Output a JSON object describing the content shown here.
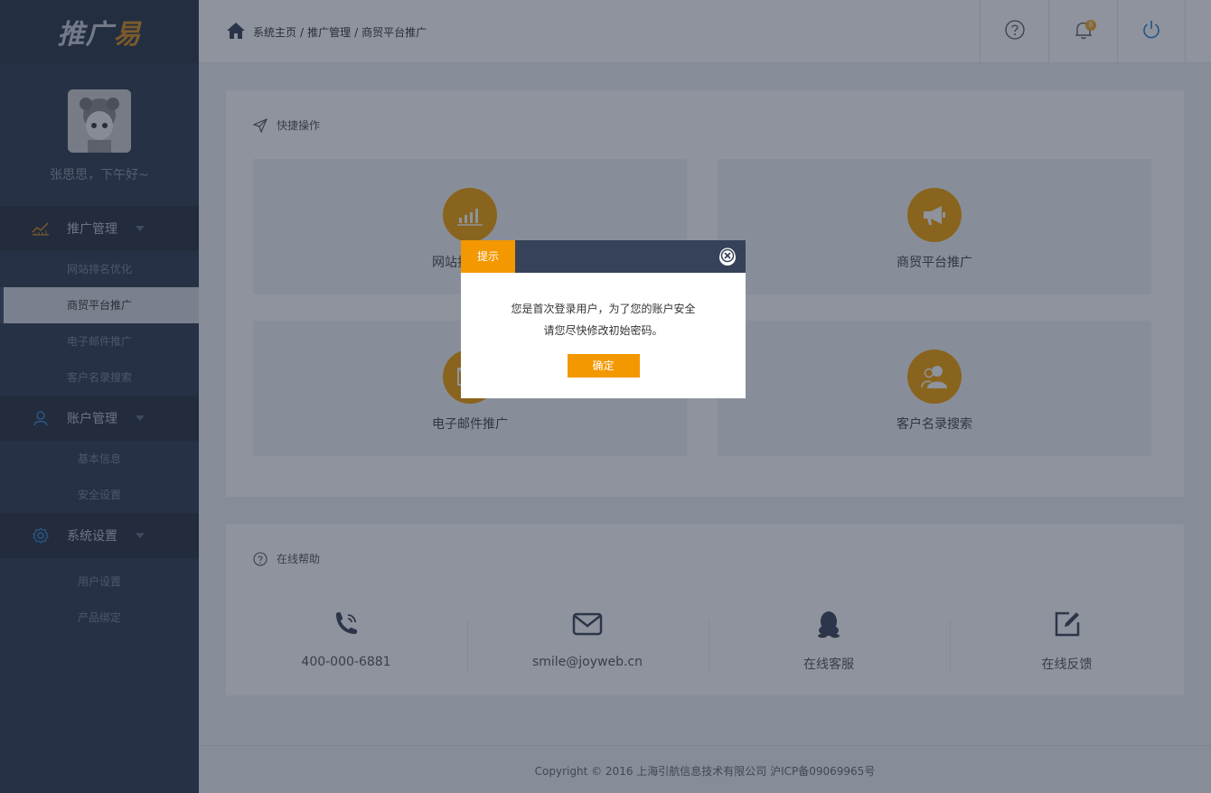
{
  "logo": {
    "text_main": "推广",
    "text_accent": "易"
  },
  "profile": {
    "greeting": "张思思，下午好~"
  },
  "nav": {
    "groups": [
      {
        "label": "推广管理",
        "items": [
          "网站排名优化",
          "商贸平台推广",
          "电子邮件推广",
          "客户名录搜索"
        ],
        "active": "商贸平台推广"
      },
      {
        "label": "账户管理",
        "items": [
          "基本信息",
          "安全设置"
        ]
      },
      {
        "label": "系统设置",
        "items": [
          "用户设置",
          "产品绑定"
        ]
      }
    ]
  },
  "breadcrumb": {
    "items": [
      "系统主页",
      "推广管理",
      "商贸平台推广"
    ],
    "separator": "/"
  },
  "header": {
    "notification_count": "8"
  },
  "quick": {
    "title": "快捷操作",
    "cards": [
      {
        "label": "网站排名优化",
        "icon": "bar-chart-icon"
      },
      {
        "label": "商贸平台推广",
        "icon": "megaphone-icon"
      },
      {
        "label": "电子邮件推广",
        "icon": "mail-icon"
      },
      {
        "label": "客户名录搜索",
        "icon": "users-icon"
      }
    ]
  },
  "help": {
    "title": "在线帮助",
    "items": [
      {
        "label": "400-000-6881",
        "icon": "phone-icon"
      },
      {
        "label": "smile@joyweb.cn",
        "icon": "envelope-icon"
      },
      {
        "label": "在线客服",
        "icon": "qq-icon"
      },
      {
        "label": "在线反馈",
        "icon": "feedback-icon"
      }
    ]
  },
  "footer": {
    "text": "Copyright © 2016 上海引航信息技术有限公司  沪ICP备09069965号"
  },
  "dialog": {
    "title": "提示",
    "line1": "您是首次登录用户，为了您的账户安全",
    "line2": "请您尽快修改初始密码。",
    "ok_label": "确定"
  },
  "colors": {
    "accent": "#f39800",
    "sidebar": "#2e3a50",
    "dialog_header": "#364259"
  }
}
